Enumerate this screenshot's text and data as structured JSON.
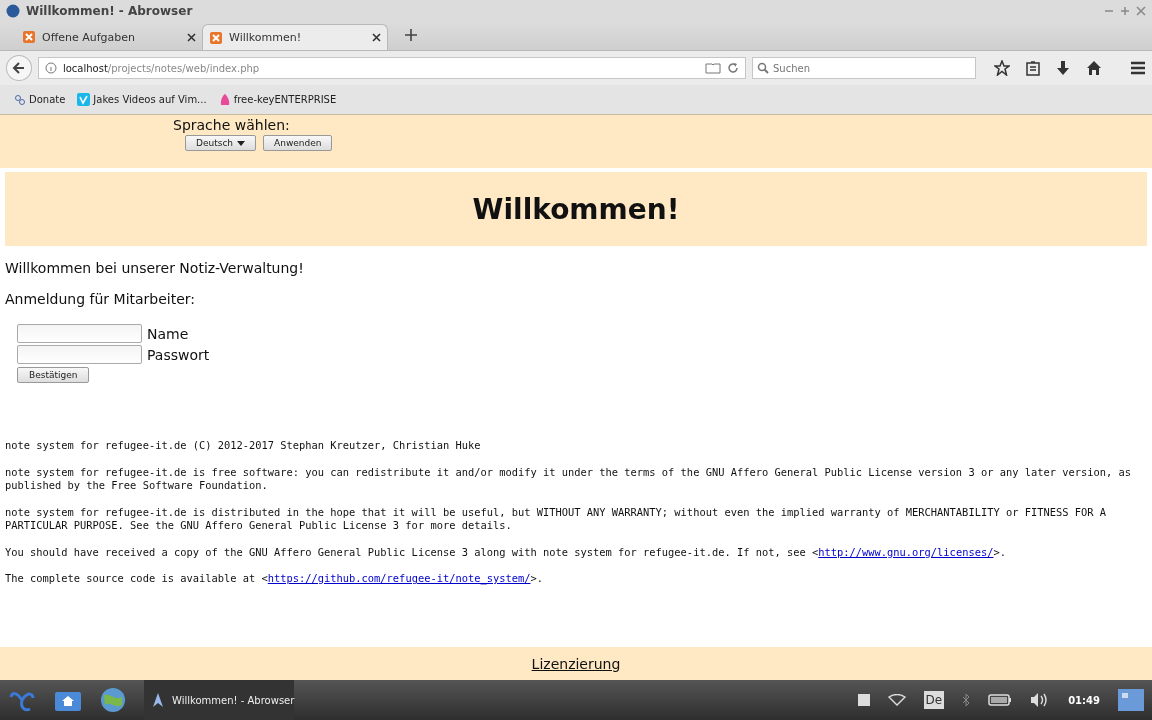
{
  "window": {
    "title": "Willkommen! - Abrowser"
  },
  "tabs": [
    {
      "label": "Offene Aufgaben",
      "selected": false
    },
    {
      "label": "Willkommen!",
      "selected": true
    }
  ],
  "address": {
    "host": "localhost",
    "path": "/projects/notes/web/index.php"
  },
  "search": {
    "placeholder": "Suchen"
  },
  "bookmarks": [
    {
      "label": "Donate"
    },
    {
      "label": "Jakes Videos auf Vim..."
    },
    {
      "label": "free-keyENTERPRISE"
    }
  ],
  "language": {
    "label": "Sprache wählen:",
    "value": "Deutsch",
    "apply": "Anwenden"
  },
  "heading": "Willkommen!",
  "intro": "Willkommen bei unserer Notiz-Verwaltung!",
  "login_title": "Anmeldung für Mitarbeiter:",
  "fields": [
    {
      "label": "Name"
    },
    {
      "label": "Passwort"
    }
  ],
  "submit": "Bestätigen",
  "license": [
    {
      "text": "note system for refugee-it.de (C) 2012-2017 Stephan Kreutzer, Christian Huke"
    },
    {
      "text": "note system for refugee-it.de is free software: you can redistribute it and/or modify it under the terms of the GNU Affero General Public License version 3 or any later version, as published by the Free Software Foundation."
    },
    {
      "text": "note system for refugee-it.de is distributed in the hope that it will be useful, but WITHOUT ANY WARRANTY; without even the implied warranty of MERCHANTABILITY or FITNESS FOR A PARTICULAR PURPOSE. See the GNU Affero General Public License 3 for more details."
    },
    {
      "text": "You should have received a copy of the GNU Affero General Public License 3 along with note system for refugee-it.de. If not, see <",
      "link": "http://www.gnu.org/licenses/",
      "after": ">."
    },
    {
      "text": "The complete source code is available at <",
      "link": "https://github.com/refugee-it/note_system/",
      "after": ">."
    }
  ],
  "footer_link": "Lizenzierung",
  "taskbar": {
    "window": "Willkommen! - Abrowser",
    "keyboard": "De",
    "clock": "01:49"
  }
}
